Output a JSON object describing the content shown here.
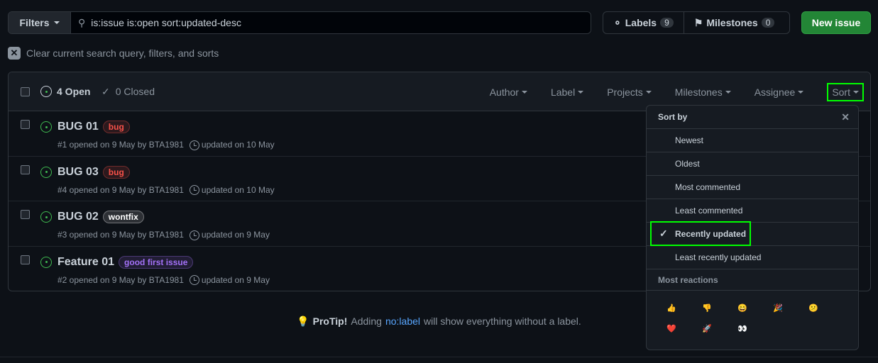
{
  "filters": {
    "label": "Filters",
    "query": "is:issue is:open sort:updated-desc"
  },
  "labels": {
    "label": "Labels",
    "count": "9"
  },
  "milestones": {
    "label": "Milestones",
    "count": "0"
  },
  "new_issue": "New issue",
  "clear": "Clear current search query, filters, and sorts",
  "header": {
    "open": "4 Open",
    "closed": "0 Closed",
    "filters": [
      "Author",
      "Label",
      "Projects",
      "Milestones",
      "Assignee",
      "Sort"
    ]
  },
  "issues": [
    {
      "title": "BUG 01",
      "label": "bug",
      "label_color": "#f85149",
      "opened": "#1 opened on 9 May by BTA1981",
      "updated": "updated on 10 May"
    },
    {
      "title": "BUG 03",
      "label": "bug",
      "label_color": "#f85149",
      "opened": "#4 opened on 9 May by BTA1981",
      "updated": "updated on 10 May"
    },
    {
      "title": "BUG 02",
      "label": "wontfix",
      "label_color": "#ffffff",
      "opened": "#3 opened on 9 May by BTA1981",
      "updated": "updated on 9 May"
    },
    {
      "title": "Feature 01",
      "label": "good first issue",
      "label_color": "#a371f7",
      "opened": "#2 opened on 9 May by BTA1981",
      "updated": "updated on 9 May"
    }
  ],
  "sort_menu": {
    "title": "Sort by",
    "items": [
      "Newest",
      "Oldest",
      "Most commented",
      "Least commented",
      "Recently updated",
      "Least recently updated"
    ],
    "selected": "Recently updated",
    "reactions_title": "Most reactions",
    "reactions": [
      "👍",
      "👎",
      "😄",
      "🎉",
      "😕",
      "❤️",
      "🚀",
      "👀"
    ]
  },
  "protip": {
    "bold": "ProTip!",
    "pre": "Adding",
    "link": "no:label",
    "post": "will show everything without a label."
  }
}
